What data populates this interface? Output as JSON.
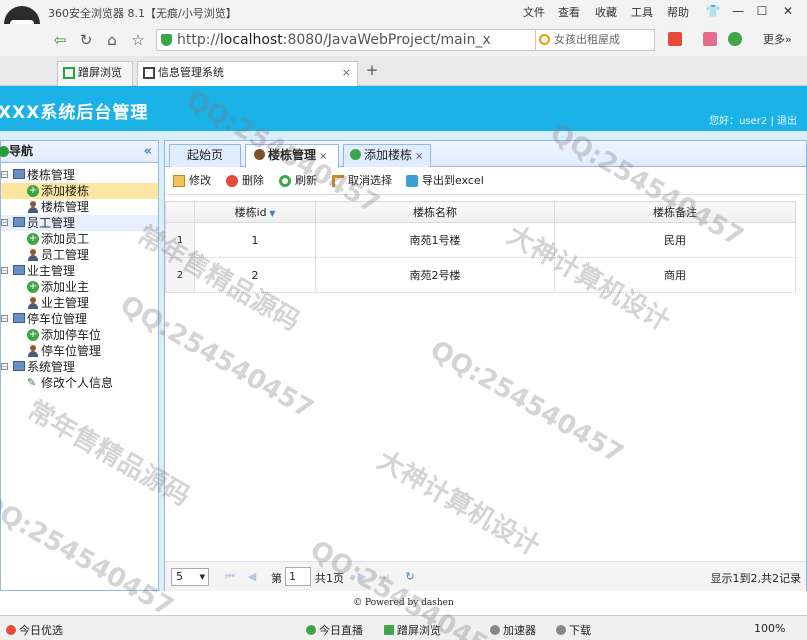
{
  "browser": {
    "title": "360安全浏览器 8.1【无痕/小号浏览】",
    "menu": [
      "文件",
      "查看",
      "收藏",
      "工具",
      "帮助"
    ],
    "url_prefix": "http://",
    "url_host": "localhost",
    "url_rest": ":8080/JavaWebProject/main_x",
    "search_placeholder": "女孩出租屋成",
    "more_label": "更多»",
    "tabs": [
      {
        "label": "蹭屏浏览"
      },
      {
        "label": "信息管理系统"
      }
    ]
  },
  "app": {
    "title": "XXX系统后台管理",
    "user_text": "您好：user2 | 退出"
  },
  "nav": {
    "title": "导航",
    "collapse_glyph": "«",
    "groups": [
      {
        "label": "楼栋管理",
        "children": [
          {
            "label": "添加楼栋"
          },
          {
            "label": "楼栋管理"
          }
        ]
      },
      {
        "label": "员工管理",
        "children": [
          {
            "label": "添加员工"
          },
          {
            "label": "员工管理"
          }
        ]
      },
      {
        "label": "业主管理",
        "children": [
          {
            "label": "添加业主"
          },
          {
            "label": "业主管理"
          }
        ]
      },
      {
        "label": "停车位管理",
        "children": [
          {
            "label": "添加停车位"
          },
          {
            "label": "停车位管理"
          }
        ]
      },
      {
        "label": "系统管理",
        "children": [
          {
            "label": "修改个人信息"
          }
        ]
      }
    ]
  },
  "tabs": [
    {
      "label": "起始页"
    },
    {
      "label": "楼栋管理"
    },
    {
      "label": "添加楼栋"
    }
  ],
  "toolbar": {
    "edit": "修改",
    "delete": "删除",
    "refresh": "刷新",
    "unselect": "取消选择",
    "export": "导出到excel"
  },
  "grid": {
    "columns": [
      "楼栋id",
      "楼栋名称",
      "楼栋备注"
    ],
    "rows": [
      {
        "num": "1",
        "id": "1",
        "name": "南苑1号楼",
        "note": "民用"
      },
      {
        "num": "2",
        "id": "2",
        "name": "南苑2号楼",
        "note": "商用"
      }
    ]
  },
  "pager": {
    "page_size": "5",
    "page_prefix": "第",
    "page_value": "1",
    "page_total": "共1页",
    "info": "显示1到2,共2记录"
  },
  "footer": {
    "text": "© Powered by dashen"
  },
  "statusbar": {
    "left": "今日优选",
    "items": [
      "今日直播",
      "蹭屏浏览",
      "加速器",
      "下载"
    ],
    "zoom": "100%"
  },
  "watermarks": {
    "qq": "QQ:254540457",
    "a": "大神计算机设计",
    "b": "常年售精品源码"
  }
}
